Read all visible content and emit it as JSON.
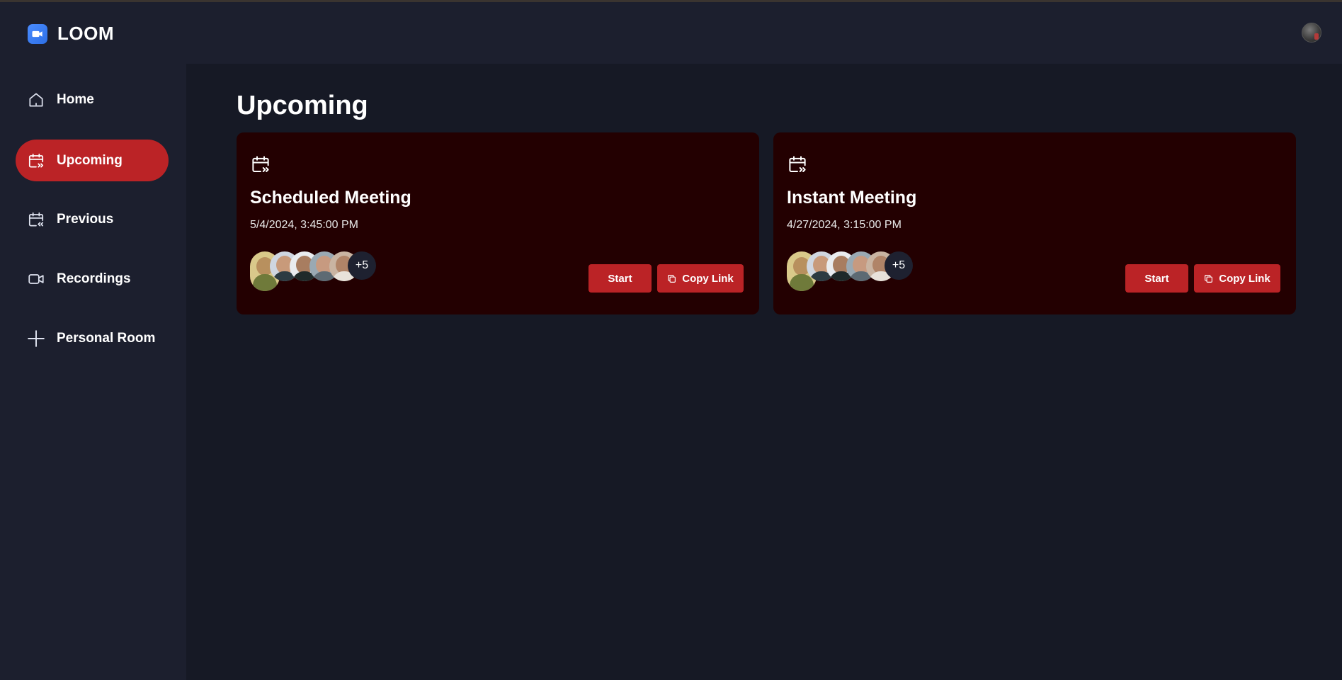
{
  "app": {
    "name": "LOOM",
    "logo_icon": "video-camera-icon",
    "accent": "#bb2326"
  },
  "sidebar": {
    "items": [
      {
        "label": "Home",
        "icon": "home-icon",
        "active": false
      },
      {
        "label": "Upcoming",
        "icon": "calendar-forward-icon",
        "active": true
      },
      {
        "label": "Previous",
        "icon": "calendar-back-icon",
        "active": false
      },
      {
        "label": "Recordings",
        "icon": "video-icon",
        "active": false
      },
      {
        "label": "Personal Room",
        "icon": "plus-icon",
        "active": false
      }
    ]
  },
  "main": {
    "title": "Upcoming",
    "meetings": [
      {
        "title": "Scheduled Meeting",
        "date": "5/4/2024, 3:45:00 PM",
        "icon": "calendar-forward-icon",
        "extra_attendees": "+5",
        "start_label": "Start",
        "copy_label": "Copy Link"
      },
      {
        "title": "Instant Meeting",
        "date": "4/27/2024, 3:15:00 PM",
        "icon": "calendar-forward-icon",
        "extra_attendees": "+5",
        "start_label": "Start",
        "copy_label": "Copy Link"
      }
    ]
  }
}
